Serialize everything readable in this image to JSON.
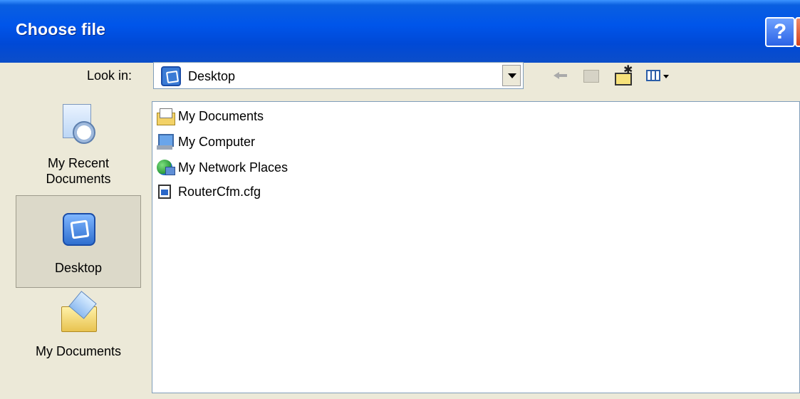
{
  "window": {
    "title": "Choose file",
    "help_label": "?",
    "close_label": "✕"
  },
  "toolbar": {
    "look_in_label": "Look in:",
    "look_in_value": "Desktop",
    "look_in_icon": "desktop-icon",
    "buttons": [
      "back-icon",
      "up-folder-icon",
      "new-folder-icon",
      "views-menu-icon"
    ]
  },
  "places": [
    {
      "label": "My Recent Documents",
      "icon": "recent-documents-icon",
      "selected": false
    },
    {
      "label": "Desktop",
      "icon": "desktop-icon",
      "selected": true
    },
    {
      "label": "My Documents",
      "icon": "my-documents-icon",
      "selected": false
    }
  ],
  "files": [
    {
      "name": "My Documents",
      "icon": "my-documents-icon"
    },
    {
      "name": "My Computer",
      "icon": "my-computer-icon"
    },
    {
      "name": "My Network Places",
      "icon": "my-network-places-icon"
    },
    {
      "name": "RouterCfm.cfg",
      "icon": "cfg-file-icon"
    }
  ],
  "colors": {
    "titlebar": "#0055ea",
    "dialog_bg": "#ece9d8",
    "list_border": "#7f9db9"
  }
}
